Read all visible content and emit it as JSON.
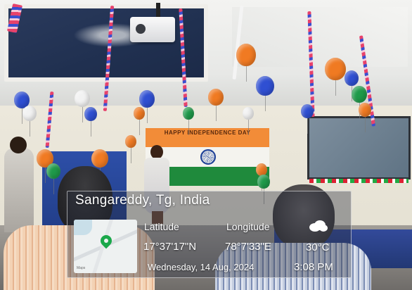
{
  "location_stamp": {
    "place": "Sangareddy, Tg, India",
    "latitude_label": "Latitude",
    "latitude_value": "17°37'17\"N",
    "longitude_label": "Longitude",
    "longitude_value": "78°7'33\"E",
    "weather_icon": "cloud-icon",
    "temperature": "30°C",
    "date": "Wednesday, 14 Aug, 2024",
    "time": "3:08 PM",
    "map": {
      "pin_icon": "map-pin-icon",
      "pin_color": "#1aa84a",
      "brand": "Maps"
    }
  },
  "scene": {
    "screen_banner": "HAPPY INDEPENDENCE DAY",
    "flag_colors": [
      "#f28c38",
      "#f4f3ee",
      "#1f8a3c"
    ],
    "balloon_colors": [
      "#2f4fd2",
      "#f07a22",
      "#1f9a4a",
      "#f2f2f2"
    ]
  }
}
